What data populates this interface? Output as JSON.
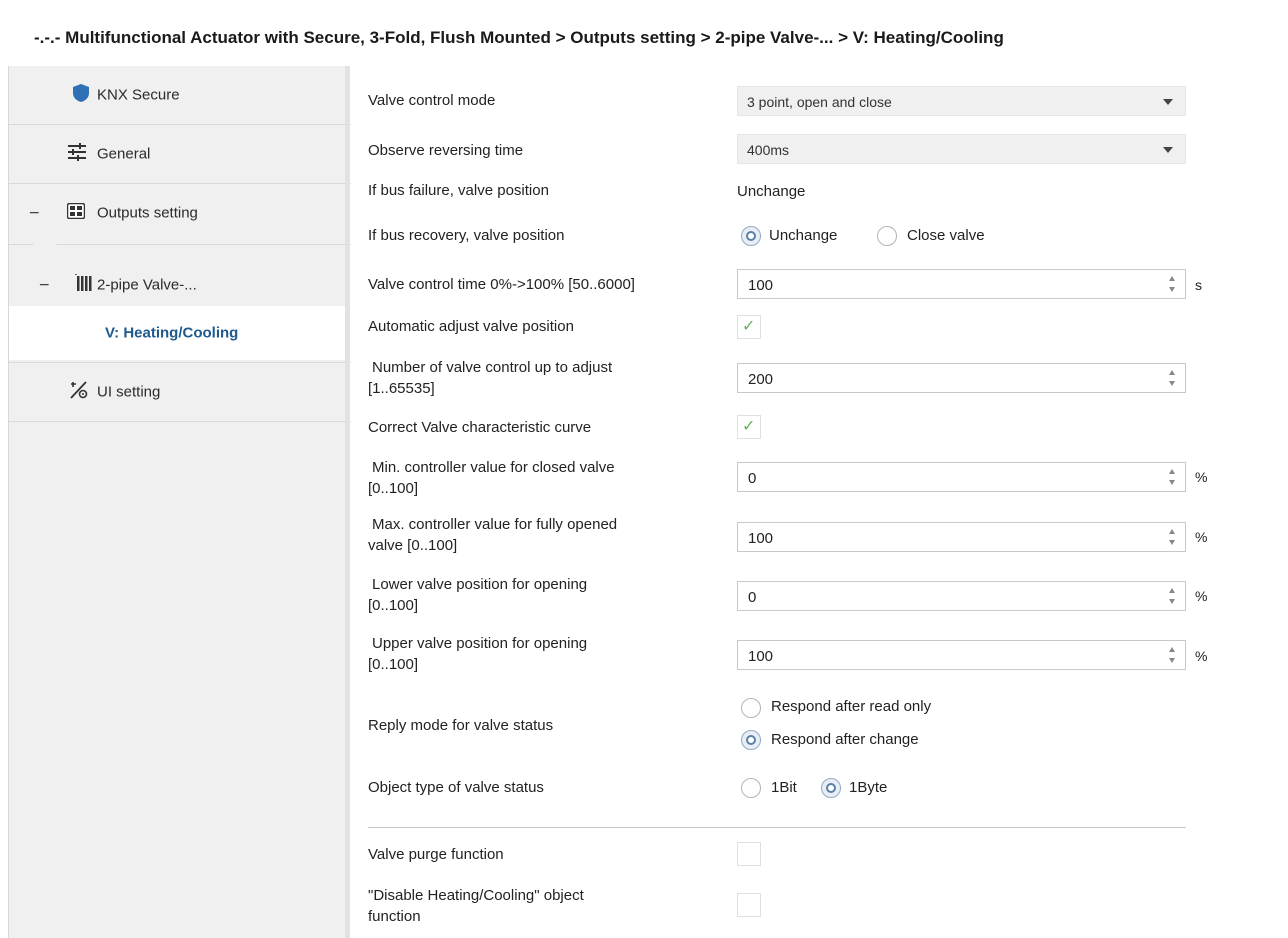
{
  "header": {
    "title": "-.-.- Multifunctional Actuator with Secure, 3-Fold, Flush Mounted > Outputs setting > 2-pipe Valve-... > V: Heating/Cooling"
  },
  "sidebar": {
    "items": [
      {
        "label": "KNX Secure",
        "icon": "shield-icon"
      },
      {
        "label": "General",
        "icon": "sliders-icon"
      },
      {
        "label": "Outputs setting",
        "icon": "grid-icon",
        "toggle": "−"
      },
      {
        "label": "2-pipe Valve-...",
        "icon": "radiator-icon",
        "toggle": "−"
      },
      {
        "label": "V: Heating/Cooling",
        "selected": true
      },
      {
        "label": "UI setting",
        "icon": "ui-setting-icon"
      }
    ]
  },
  "params": {
    "valve_control_mode": {
      "label": "Valve control mode",
      "value": "3 point, open and close"
    },
    "reversing_time": {
      "label": "Observe reversing time",
      "value": "400ms"
    },
    "bus_failure": {
      "label": "If bus failure, valve position",
      "value": "Unchange"
    },
    "bus_recovery": {
      "label": "If bus recovery, valve position",
      "options": [
        "Unchange",
        "Close valve"
      ],
      "selected": "Unchange"
    },
    "control_time": {
      "label": "Valve control time 0%->100% [50..6000]",
      "value": "100",
      "unit": "s"
    },
    "auto_adjust": {
      "label": "Automatic adjust valve position",
      "checked": true
    },
    "num_control": {
      "label_line1": "Number of valve control up to adjust",
      "label_line2": "[1..65535]",
      "value": "200"
    },
    "correct_curve": {
      "label": "Correct Valve characteristic curve",
      "checked": true
    },
    "min_controller": {
      "label_line1": "Min. controller value for closed valve",
      "label_line2": "[0..100]",
      "value": "0",
      "unit": "%"
    },
    "max_controller": {
      "label_line1": "Max. controller value for fully opened",
      "label_line2": "valve [0..100]",
      "value": "100",
      "unit": "%"
    },
    "lower_position": {
      "label_line1": "Lower valve position for opening",
      "label_line2": "[0..100]",
      "value": "0",
      "unit": "%"
    },
    "upper_position": {
      "label_line1": "Upper valve position for opening",
      "label_line2": "[0..100]",
      "value": "100",
      "unit": "%"
    },
    "reply_mode": {
      "label": "Reply mode for valve status",
      "options": [
        "Respond after read only",
        "Respond after change"
      ],
      "selected": "Respond after change"
    },
    "object_type": {
      "label": "Object type of valve status",
      "options": [
        "1Bit",
        "1Byte"
      ],
      "selected": "1Byte"
    },
    "purge": {
      "label": "Valve purge function",
      "checked": false
    },
    "disable_hc": {
      "label_line1": "\"Disable Heating/Cooling\" object",
      "label_line2": "function",
      "checked": false
    }
  },
  "colors": {
    "accent": "#1f5a8f",
    "check": "#62b05c",
    "shield": "#2f6fb3"
  }
}
